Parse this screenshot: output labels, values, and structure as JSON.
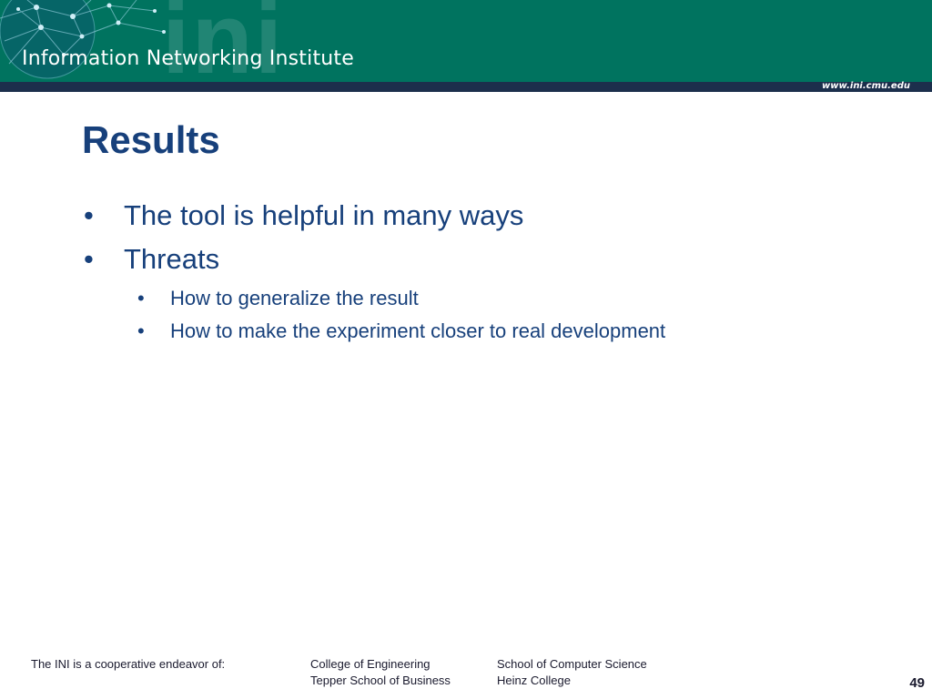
{
  "header": {
    "org_name": "Information Networking Institute",
    "watermark": "ini",
    "url": "www.ini.cmu.edu",
    "brand_color": "#00735f",
    "bar_color": "#1c2f4c"
  },
  "slide": {
    "title": "Results",
    "text_color": "#17407b",
    "bullets": [
      {
        "level": 1,
        "text": "The tool is helpful in many ways"
      },
      {
        "level": 1,
        "text": "Threats"
      },
      {
        "level": 2,
        "text": "How to generalize the result"
      },
      {
        "level": 2,
        "text": "How to make the experiment closer to real development"
      }
    ],
    "bullet_glyph": "•"
  },
  "footer": {
    "intro": "The INI is a cooperative endeavor of:",
    "col1": [
      "College of Engineering",
      "Tepper School of Business"
    ],
    "col2": [
      "School of Computer Science",
      "Heinz College"
    ],
    "page_number": "49"
  }
}
